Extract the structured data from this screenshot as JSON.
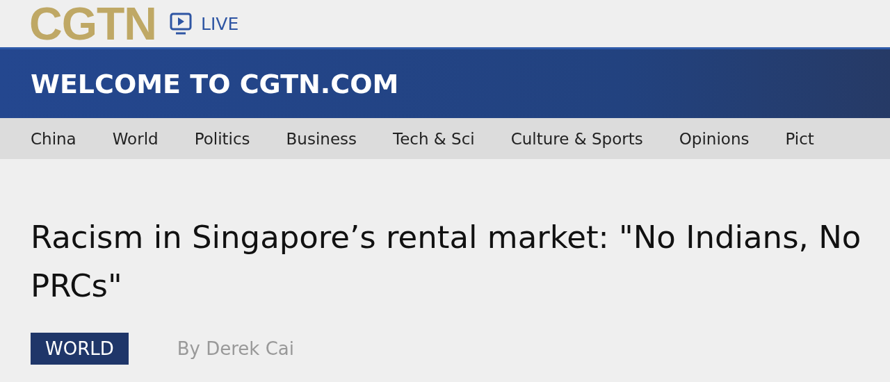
{
  "header": {
    "logo": "CGTN",
    "live_label": "LIVE"
  },
  "banner": {
    "title": "WELCOME TO CGTN.COM"
  },
  "nav": {
    "items": [
      {
        "label": "China"
      },
      {
        "label": "World"
      },
      {
        "label": "Politics"
      },
      {
        "label": "Business"
      },
      {
        "label": "Tech & Sci"
      },
      {
        "label": "Culture & Sports"
      },
      {
        "label": "Opinions"
      },
      {
        "label": "Pict"
      }
    ]
  },
  "article": {
    "headline": "Racism in Singapore’s rental market: \"No Indians, No PRCs\"",
    "category": "WORLD",
    "byline": "By Derek Cai"
  }
}
